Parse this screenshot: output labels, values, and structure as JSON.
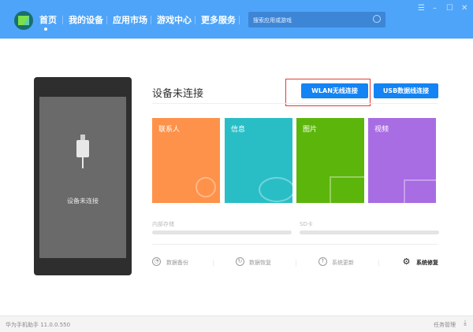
{
  "header": {
    "nav": [
      "首页",
      "我的设备",
      "应用市场",
      "游戏中心",
      "更多服务"
    ],
    "active_index": 0,
    "search_placeholder": "搜索应用或游戏",
    "bg_color": "#4ea4f8"
  },
  "phone": {
    "status_text": "设备未连接"
  },
  "main": {
    "title": "设备未连接",
    "wlan_button": "WLAN无线连接",
    "usb_button": "USB数据线连接",
    "tiles": [
      {
        "label": "联系人",
        "color": "#fe924a",
        "icon": "contact-icon"
      },
      {
        "label": "信息",
        "color": "#29bec6",
        "icon": "message-icon"
      },
      {
        "label": "图片",
        "color": "#5cb50b",
        "icon": "picture-icon"
      },
      {
        "label": "视频",
        "color": "#a86ce3",
        "icon": "video-icon"
      }
    ],
    "storage": {
      "internal": "内部存储",
      "sd": "SD卡"
    },
    "actions": [
      "数据备份",
      "数据恢复",
      "系统更新",
      "系统修复"
    ]
  },
  "status": {
    "version": "华为手机助手 11.0.0.550",
    "task_manager": "任务管理"
  }
}
